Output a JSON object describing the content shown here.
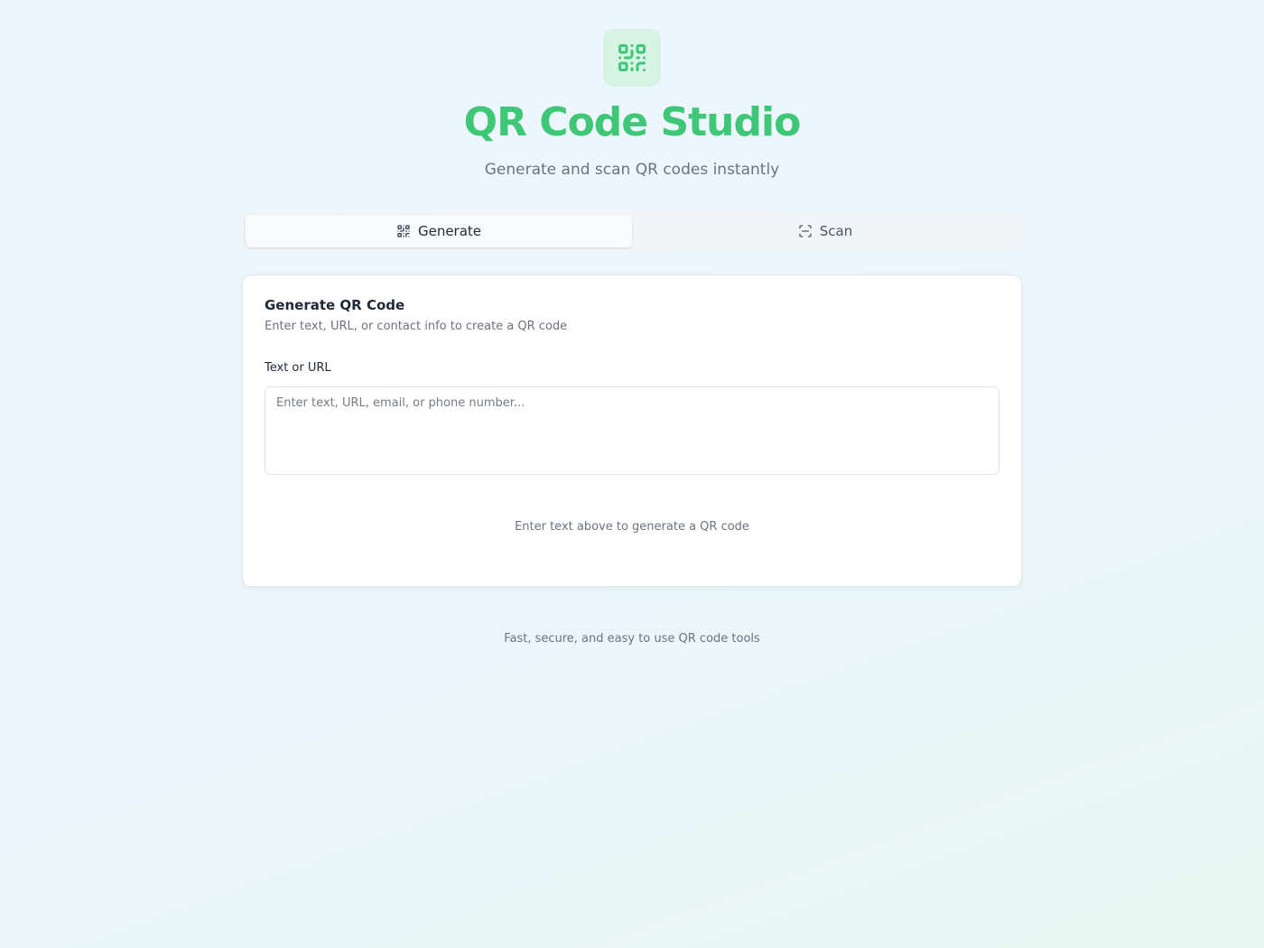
{
  "app": {
    "logo_icon": "qr-code-icon",
    "title": "QR Code Studio",
    "subtitle": "Generate and scan QR codes instantly",
    "accent_color": "#3ec777"
  },
  "tabs": [
    {
      "label": "Generate",
      "icon": "qr-code-icon",
      "active": true
    },
    {
      "label": "Scan",
      "icon": "scan-icon",
      "active": false
    }
  ],
  "generate_card": {
    "title": "Generate QR Code",
    "description": "Enter text, URL, or contact info to create a QR code",
    "field_label": "Text or URL",
    "input_value": "",
    "input_placeholder": "Enter text, URL, email, or phone number...",
    "empty_state": "Enter text above to generate a QR code"
  },
  "footer": {
    "text": "Fast, secure, and easy to use QR code tools"
  }
}
